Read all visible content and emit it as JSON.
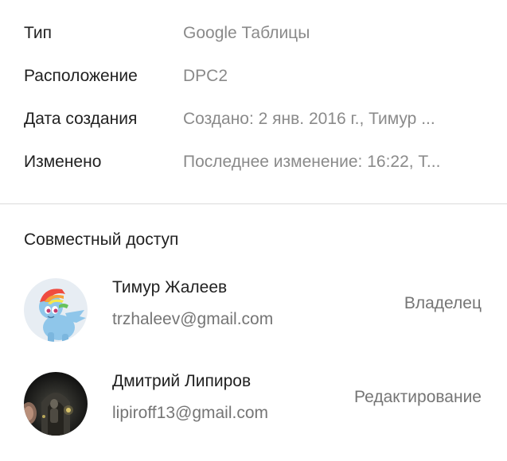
{
  "details": {
    "type": {
      "label": "Тип",
      "value": "Google Таблицы"
    },
    "location": {
      "label": "Расположение",
      "value": "DPC2"
    },
    "created": {
      "label": "Дата создания",
      "value": "Создано: 2 янв. 2016 г., Тимур ..."
    },
    "modified": {
      "label": "Изменено",
      "value": "Последнее изменение: 16:22, Т..."
    }
  },
  "sharing": {
    "title": "Совместный доступ",
    "people": [
      {
        "name": "Тимур Жалеев",
        "email": "trzhaleev@gmail.com",
        "role": "Владелец",
        "avatar": "pony-avatar-icon"
      },
      {
        "name": "Дмитрий Липиров",
        "email": "lipiroff13@gmail.com",
        "role": "Редактирование",
        "avatar": "dark-photo-avatar-icon"
      }
    ]
  },
  "colors": {
    "label_text": "#212121",
    "value_text": "#8a8a8a",
    "secondary_text": "#757575",
    "divider": "#dadada"
  }
}
